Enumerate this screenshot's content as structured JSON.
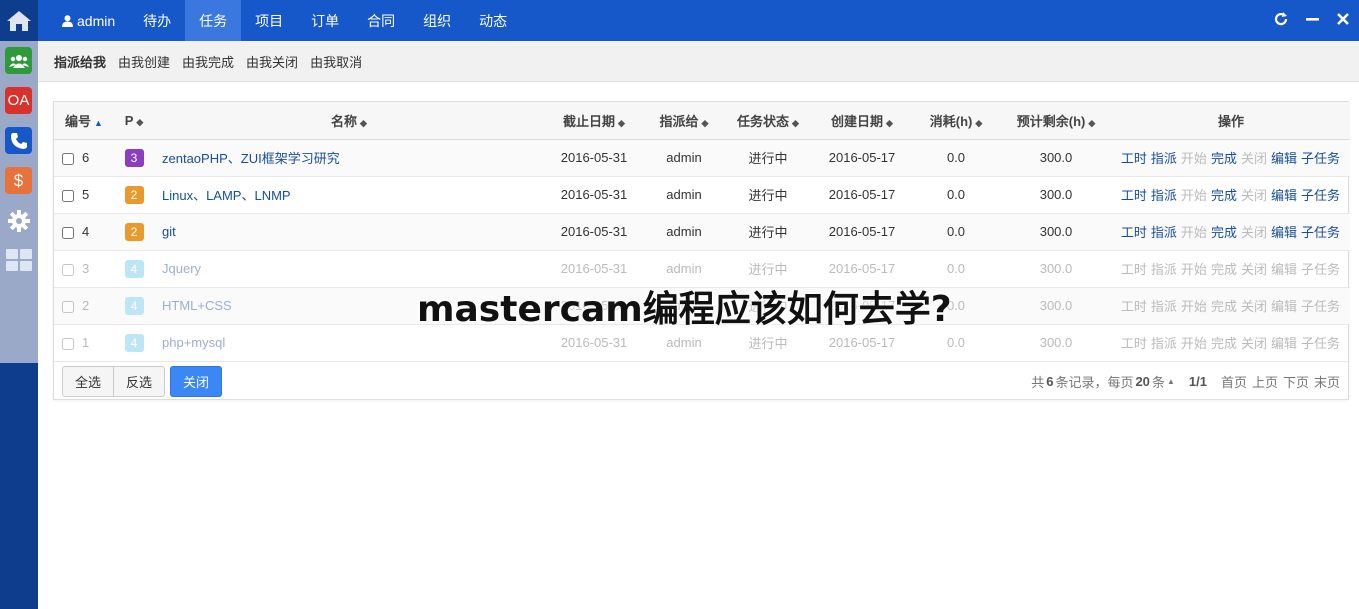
{
  "leftbar": {
    "apps": [
      {
        "name": "home-icon",
        "color": "#0d3d8c"
      },
      {
        "name": "team-icon",
        "label": "",
        "color": "#2e9a3a"
      },
      {
        "name": "oa-icon",
        "label": "OA",
        "color": "#d9312b"
      },
      {
        "name": "phone-icon",
        "label": "",
        "color": "#1658c9"
      },
      {
        "name": "dollar-icon",
        "label": "$",
        "color": "#e8733a"
      },
      {
        "name": "gear-icon",
        "label": "",
        "color": "#0d3d8c"
      },
      {
        "name": "grid-icon",
        "label": "",
        "color": "#9aa9c8"
      }
    ]
  },
  "topbar": {
    "user": "admin",
    "nav": [
      "待办",
      "任务",
      "项目",
      "订单",
      "合同",
      "组织",
      "动态"
    ],
    "active": "任务",
    "controls": [
      "refresh-icon",
      "minimize-icon",
      "close-icon"
    ]
  },
  "subnav": {
    "items": [
      "指派给我",
      "由我创建",
      "由我完成",
      "由我关闭",
      "由我取消"
    ],
    "active": "指派给我"
  },
  "table": {
    "headers": [
      "编号",
      "P",
      "名称",
      "截止日期",
      "指派给",
      "任务状态",
      "创建日期",
      "消耗(h)",
      "预计剩余(h)",
      "操作"
    ],
    "actions": [
      "工时",
      "指派",
      "开始",
      "完成",
      "关闭",
      "编辑",
      "子任务"
    ],
    "rows": [
      {
        "id": "6",
        "pri": "3",
        "pri_color": "#8b3fbf",
        "name": "zentaoPHP、ZUI框架学习研究",
        "deadline": "2016-05-31",
        "assignee": "admin",
        "status": "进行中",
        "created": "2016-05-17",
        "consumed": "0.0",
        "left": "300.0",
        "done": false
      },
      {
        "id": "5",
        "pri": "2",
        "pri_color": "#e99a2e",
        "name": "Linux、LAMP、LNMP",
        "deadline": "2016-05-31",
        "assignee": "admin",
        "status": "进行中",
        "created": "2016-05-17",
        "consumed": "0.0",
        "left": "300.0",
        "done": false
      },
      {
        "id": "4",
        "pri": "2",
        "pri_color": "#e99a2e",
        "name": "git",
        "deadline": "2016-05-31",
        "assignee": "admin",
        "status": "进行中",
        "created": "2016-05-17",
        "consumed": "0.0",
        "left": "300.0",
        "done": false
      },
      {
        "id": "3",
        "pri": "4",
        "pri_color": "#b7e3f3",
        "name": "Jquery",
        "deadline": "2016-05-31",
        "assignee": "admin",
        "status": "进行中",
        "created": "2016-05-17",
        "consumed": "0.0",
        "left": "300.0",
        "done": true
      },
      {
        "id": "2",
        "pri": "4",
        "pri_color": "#b7e3f3",
        "name": "HTML+CSS",
        "deadline": "2016-05-31",
        "assignee": "admin",
        "status": "进行中",
        "created": "2016-05-17",
        "consumed": "0.0",
        "left": "300.0",
        "done": true
      },
      {
        "id": "1",
        "pri": "4",
        "pri_color": "#b7e3f3",
        "name": "php+mysql",
        "deadline": "2016-05-31",
        "assignee": "admin",
        "status": "进行中",
        "created": "2016-05-17",
        "consumed": "0.0",
        "left": "300.0",
        "done": true
      }
    ]
  },
  "footer": {
    "select_all": "全选",
    "invert": "反选",
    "close": "关闭",
    "pager_prefix": "共",
    "total": "6",
    "pager_records": "条记录，每页",
    "per_page": "20",
    "pager_unit": "条",
    "page": "1/1",
    "first": "首页",
    "prev": "上页",
    "next": "下页",
    "last": "末页"
  },
  "overlay_title": "mastercam编程应该如何去学?"
}
